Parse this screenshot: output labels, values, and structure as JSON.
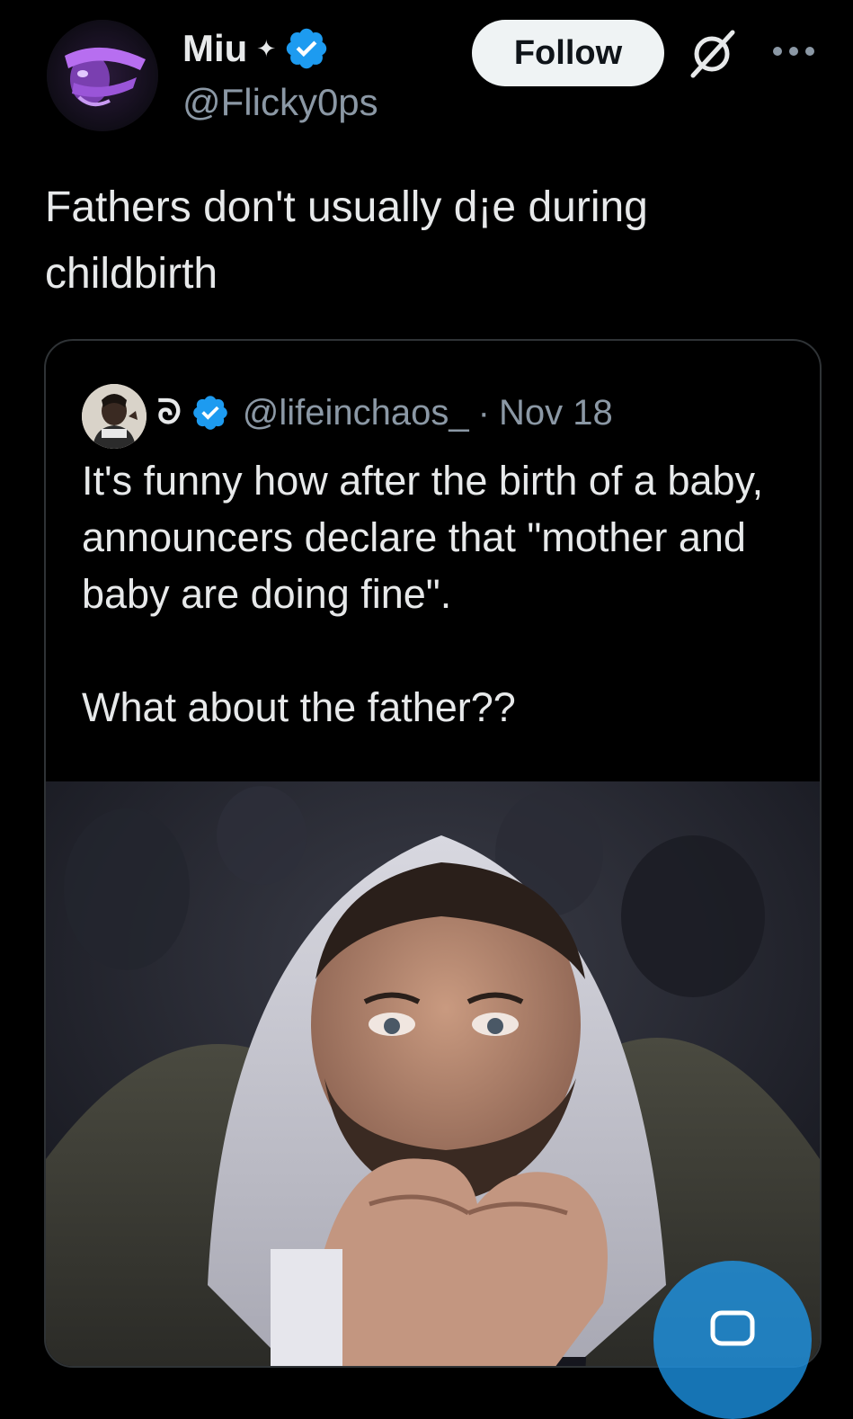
{
  "author": {
    "display_name": "Miu",
    "name_decoration": "✦",
    "handle": "@Flicky0ps",
    "avatar": "purple-face-avatar",
    "verified_icon": "verified-badge-icon"
  },
  "actions": {
    "follow_label": "Follow",
    "grok_icon": "slashed-circle-icon",
    "more_icon": "more-dots-icon"
  },
  "post": {
    "text": "Fathers don't usually d¡e during childbirth"
  },
  "quoted": {
    "display_name": "ᘐ",
    "handle": "@lifeinchaos_",
    "separator": "·",
    "date": "Nov 18",
    "text": "It's funny how after the birth of a baby, announcers declare that \"mother and baby are doing fine\".\n\nWhat about the father??",
    "photo": "crying-man-in-hoodie-photo"
  },
  "colors": {
    "background": "#000000",
    "text_primary": "#e7e9ea",
    "text_secondary": "#8b98a5",
    "verified_blue": "#1d9bf0",
    "border": "#2f3336"
  }
}
